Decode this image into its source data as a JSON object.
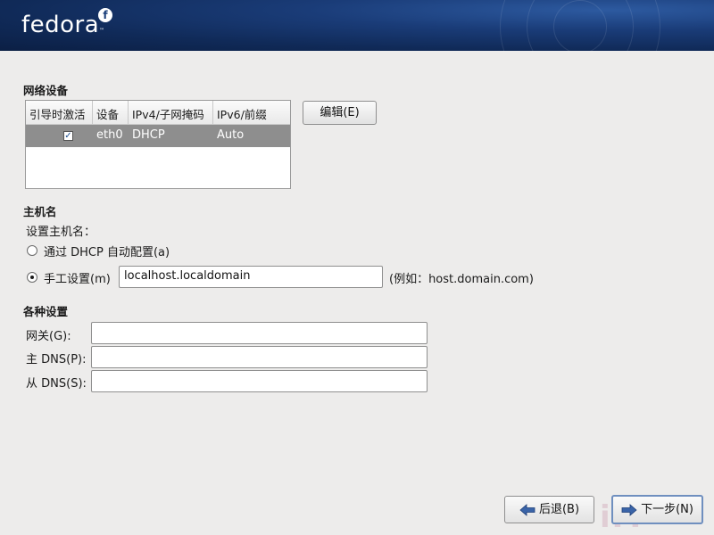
{
  "banner": {
    "logo_text": "fedora",
    "logo_mark": "f",
    "logo_tm": "™"
  },
  "network": {
    "title": "网络设备",
    "columns": [
      "引导时激活",
      "设备",
      "IPv4/子网掩码",
      "IPv6/前缀"
    ],
    "rows": [
      {
        "active": true,
        "device": "eth0",
        "ipv4": "DHCP",
        "ipv6": "Auto"
      }
    ],
    "edit_button": "编辑(E)"
  },
  "hostname": {
    "title": "主机名",
    "prompt": "设置主机名：",
    "option_dhcp": "通过  DHCP 自动配置(a)",
    "option_manual": "手工设置(m)",
    "selected": "manual",
    "value": "localhost.localdomain",
    "example": "(例如：host.domain.com)"
  },
  "misc": {
    "title": "各种设置",
    "gateway_label": "网关(G):",
    "gateway_value": "",
    "dns1_label": "主  DNS(P):",
    "dns1_value": "",
    "dns2_label": "从  DNS(S):",
    "dns2_value": ""
  },
  "footer": {
    "back_button": "后退(B)",
    "next_button": "下一步(N)"
  }
}
